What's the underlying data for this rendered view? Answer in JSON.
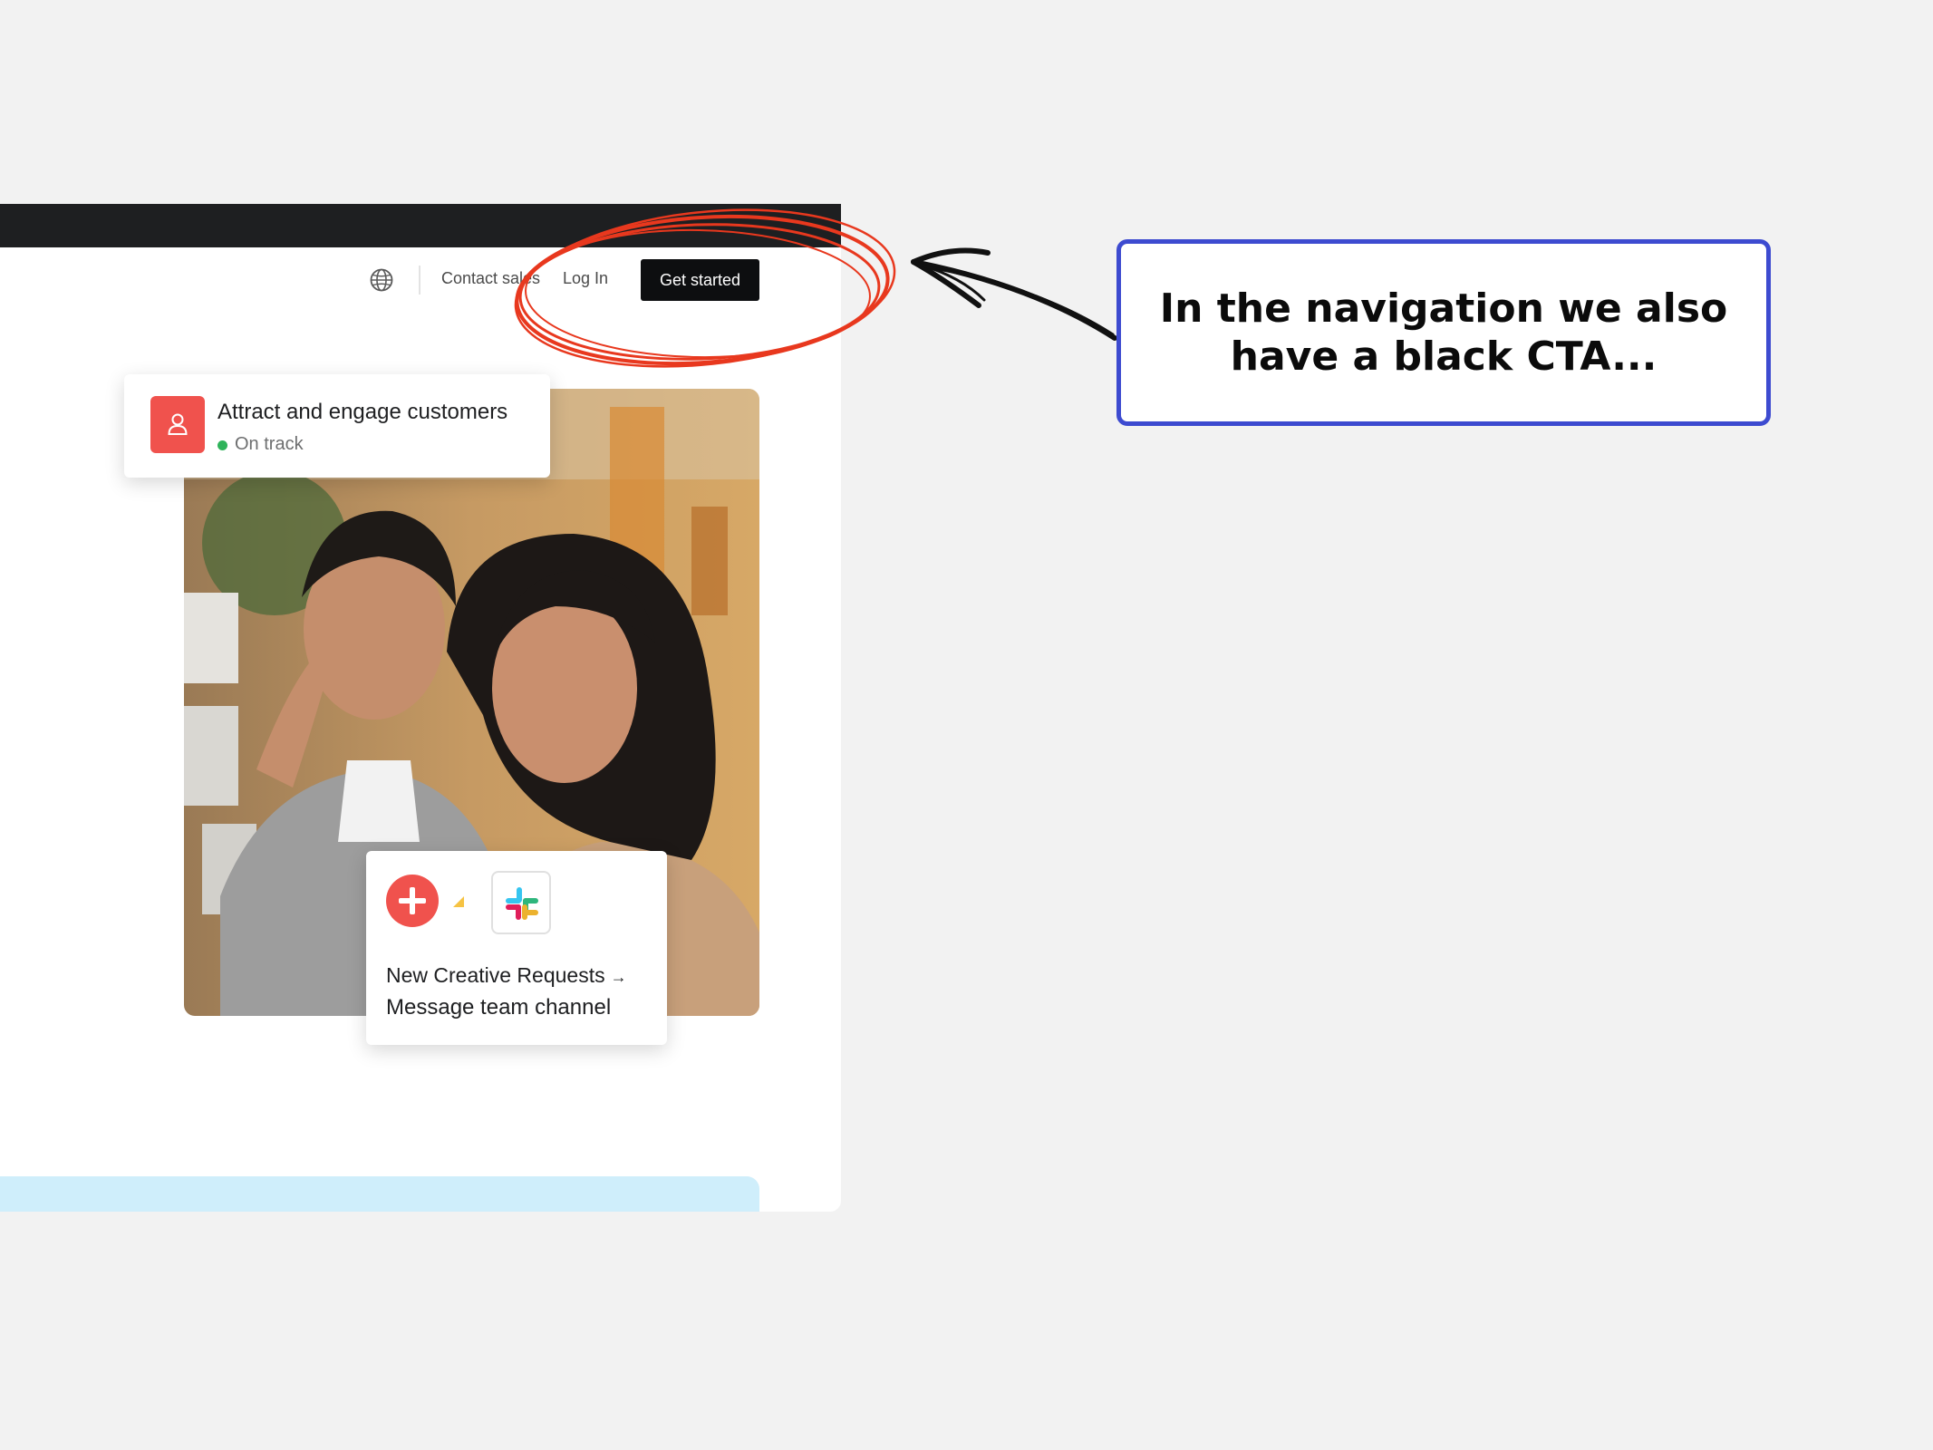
{
  "nav": {
    "globe_icon": "globe-icon",
    "contact_label": "Contact sales",
    "login_label": "Log In",
    "cta_label": "Get started",
    "cta_color": "#0d0e10"
  },
  "goal_card": {
    "icon": "person-icon",
    "title": "Attract and engage customers",
    "status": "On track",
    "status_color": "#2fb35a",
    "icon_color": "#f0524d"
  },
  "rule_card": {
    "trigger_icon": "plus-icon",
    "app_icon": "slack-icon",
    "line1": "New Creative Requests",
    "arrow": "→",
    "line2": "Message team channel"
  },
  "annotation": {
    "callout_text": "In the navigation we also have a black CTA...",
    "callout_border_color": "#3d4bd0",
    "scribble_color": "#e8381e"
  }
}
